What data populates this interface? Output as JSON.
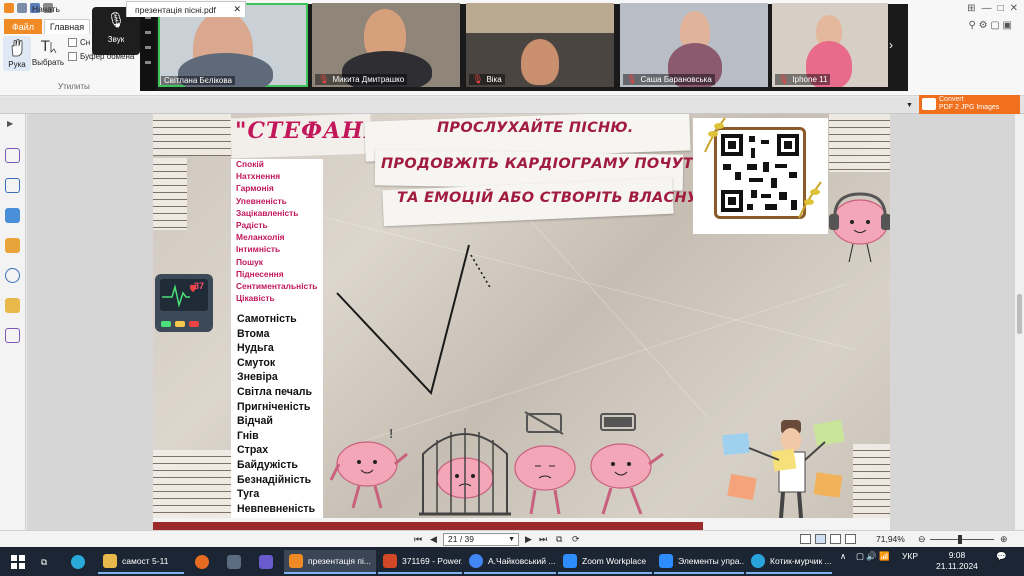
{
  "ribbon": {
    "file_tab": "Файл",
    "home_tab": "Главная",
    "hand_label": "Рука",
    "select_label": "Выбрать",
    "snapshot_label": "Сн",
    "clipboard_label": "Буфер обмена",
    "group_label": "Утилиты"
  },
  "zoom": {
    "audio_label": "Звук",
    "participants": [
      {
        "name": "Світлана Бєлікова",
        "muted": false
      },
      {
        "name": "Микита Дмитрашко",
        "muted": true
      },
      {
        "name": "Віка",
        "muted": true
      },
      {
        "name": "Саша Барановська",
        "muted": true
      },
      {
        "name": "Iphone 11",
        "muted": true
      }
    ]
  },
  "tabs": {
    "start": "Начать",
    "document": "презентація пісні.pdf",
    "convert_line1": "Convert",
    "convert_line2": "PDF 2 JPG Images"
  },
  "slide": {
    "title": "\"СТЕФАНІЯ\"",
    "instruction_lines": [
      "ПРОСЛУХАЙТЕ ПІСНЮ.",
      "ПРОДОВЖІТЬ КАРДІОГРАМУ ПОЧУТТІВ",
      "ТА ЕМОЦІЙ  АБО СТВОРІТЬ ВЛАСНУ"
    ],
    "monitor_value": "37",
    "positive_emotions": [
      "Спокій",
      "Натхнення",
      "Гармонія",
      "Упевненість",
      "Зацікавленість",
      "Радість",
      "Меланхолія",
      "Інтимність",
      "Пошук",
      "Піднесення",
      "Сентиментальність",
      "Цікавість"
    ],
    "negative_emotions": [
      "Самотність",
      "Втома",
      "Нудьга",
      "Смуток",
      "Зневіра",
      "Світла печаль",
      "Пригніченість",
      "Відчай",
      "Гнів",
      "Страх",
      "Байдужість",
      "Безнадійність",
      "Туга",
      "Невпевненість"
    ],
    "colors": {
      "pink": "#c2185b",
      "instruction": "#a11b3e"
    }
  },
  "navbar": {
    "page_indicator": "21 / 39",
    "zoom_level": "71,94%"
  },
  "taskbar": {
    "items": [
      {
        "label": "самост 5-11",
        "color": "#e8b84a"
      },
      {
        "label": "презентація пі...",
        "color": "#f08a24"
      },
      {
        "label": "371169 - Power...",
        "color": "#d24726"
      },
      {
        "label": "А.Чайковський ...",
        "color": "#4285f4"
      },
      {
        "label": "Zoom Workplace",
        "color": "#2d8cff"
      },
      {
        "label": "Элементы упра...",
        "color": "#2d8cff"
      },
      {
        "label": "Котик-мурчик ...",
        "color": "#2aa3dd"
      }
    ],
    "language": "УКР",
    "time": "9:08",
    "date": "21.11.2024"
  }
}
